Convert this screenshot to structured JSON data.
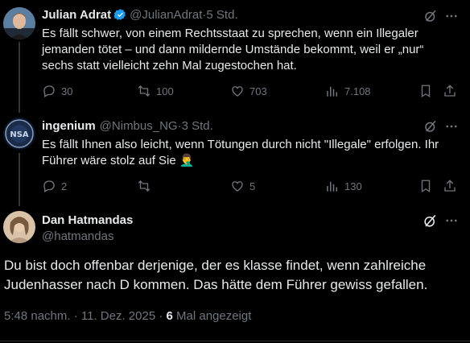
{
  "tweets": [
    {
      "name": "Julian Adrat",
      "handle": "@JulianAdrat",
      "sep": " · ",
      "time": "5 Std.",
      "text": "Es fällt schwer, von einem Rechtsstaat zu sprechen, wenn ein Illegaler jemanden tötet – und dann mildernde Umstände bekommt, weil er „nur“ sechs statt vielleicht zehn Mal zugestochen hat.",
      "replies": "30",
      "reposts": "100",
      "likes": "703",
      "views": "7.108"
    },
    {
      "name": "ingenium",
      "handle": "@Nimbus_NG",
      "sep": " · ",
      "time": "3 Std.",
      "text": "Es fällt Ihnen also leicht, wenn  Tötungen durch nicht \"Illegale\" erfolgen. Ihr Führer wäre stolz auf Sie 🤦‍♂️",
      "replies": "2",
      "reposts": "",
      "likes": "5",
      "views": "130",
      "avatar_label": "NSA"
    }
  ],
  "main": {
    "name": "Dan Hatmandas",
    "handle": "@hatmandas",
    "text": "Du bist doch offenbar derjenige, der es klasse findet, wenn zahlreiche Judenhasser nach D kommen. Das hätte dem Führer gewiss gefallen.",
    "timestamp": "5:48 nachm. · 11. Dez. 2025 · ",
    "view_count": "6",
    "view_suffix": " Mal angezeigt"
  },
  "colors": {
    "background": "#000000",
    "text": "#e7e9ea",
    "muted": "#71767b",
    "verified": "#1d9bf0"
  }
}
